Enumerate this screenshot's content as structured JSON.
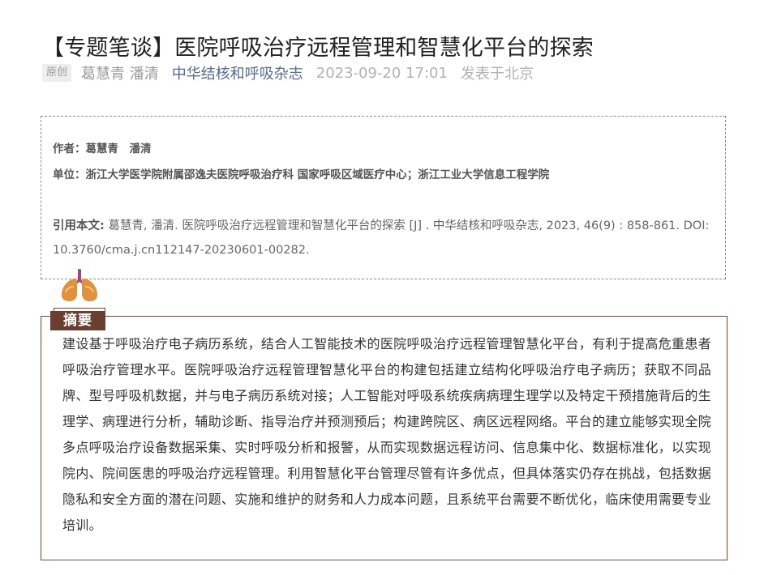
{
  "article": {
    "title": "【专题笔谈】医院呼吸治疗远程管理和智慧化平台的探索"
  },
  "meta": {
    "badge": "原创",
    "authors": "葛慧青 潘清",
    "journal": "中华结核和呼吸杂志",
    "datetime": "2023-09-20 17:01",
    "location": "发表于北京"
  },
  "info": {
    "author_line": "作者：葛慧青　潘清",
    "unit_line": "单位：浙江大学医学院附属邵逸夫医院呼吸治疗科 国家呼吸区域医疗中心；浙江工业大学信息工程学院",
    "citation_label": "引用本文:",
    "citation_text": " 葛慧青, 潘清. 医院呼吸治疗远程管理和智慧化平台的探索 [J] . 中华结核和呼吸杂志, 2023, 46(9) : 858-861. DOI: 10.3760/cma.j.cn112147-20230601-00282."
  },
  "abstract": {
    "heading": "摘要",
    "text": "建设基于呼吸治疗电子病历系统，结合人工智能技术的医院呼吸治疗远程管理智慧化平台，有利于提高危重患者呼吸治疗管理水平。医院呼吸治疗远程管理智慧化平台的构建包括建立结构化呼吸治疗电子病历；获取不同品牌、型号呼吸机数据，并与电子病历系统对接；人工智能对呼吸系统疾病病理生理学以及特定干预措施背后的生理学、病理进行分析，辅助诊断、指导治疗并预测预后；构建跨院区、病区远程网络。平台的建立能够实现全院多点呼吸治疗设备数据采集、实时呼吸分析和报警，从而实现数据远程访问、信息集中化、数据标准化，以实现院内、院间医患的呼吸治疗远程管理。利用智慧化平台管理尽管有许多优点，但具体落实仍存在挑战，包括数据隐私和安全方面的潜在问题、实施和维护的财务和人力成本问题，且系统平台需要不断优化，临床使用需要专业培训。"
  },
  "colors": {
    "journal_link": "#576b95",
    "abstract_brown": "#6b3f30",
    "lung_orange": "#e0913a",
    "trachea_purple": "#b0407a"
  },
  "icons": {
    "lungs": "lungs-icon"
  }
}
